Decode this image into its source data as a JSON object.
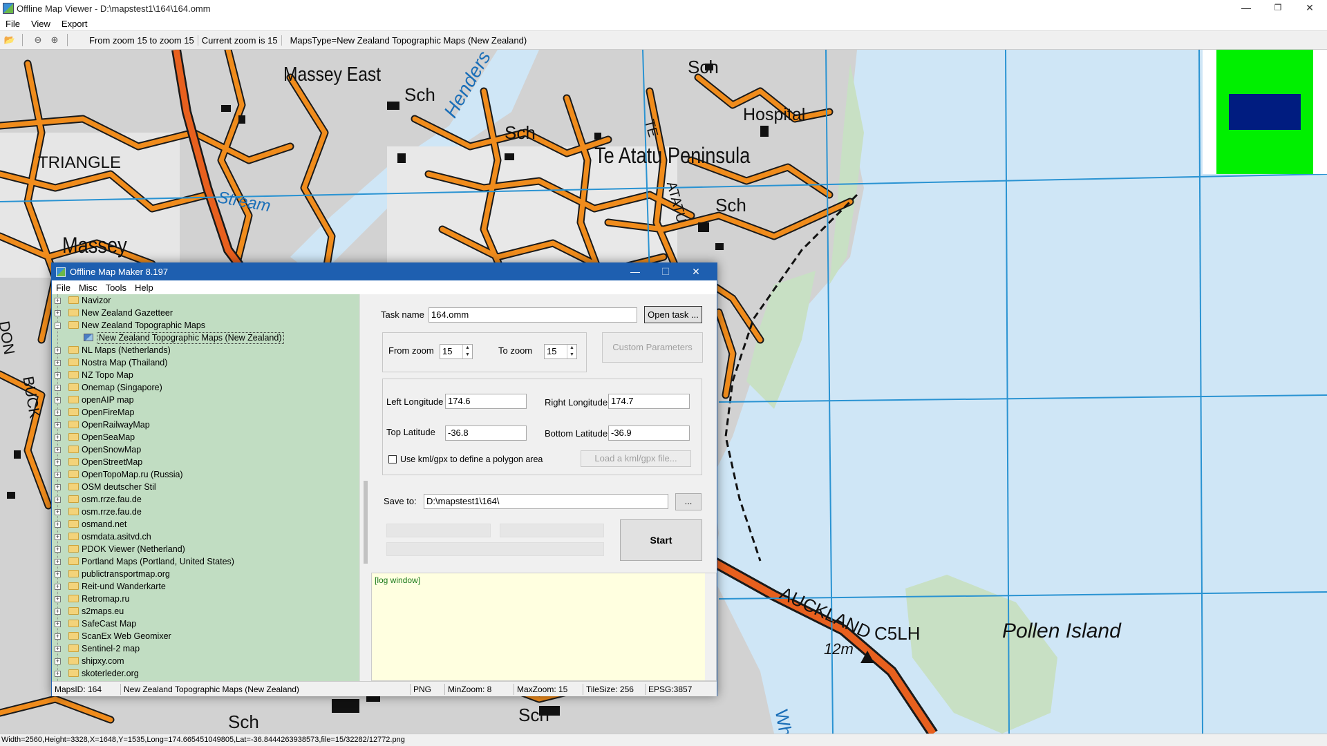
{
  "window": {
    "title": "Offline Map Viewer - D:\\mapstest1\\164\\164.omm",
    "controls": {
      "minimize": "—",
      "restore": "❐",
      "close": "✕"
    }
  },
  "menubar": [
    "File",
    "View",
    "Export"
  ],
  "toolbar": {
    "icons": [
      "open-folder-icon",
      "zoom-out-icon",
      "zoom-in-icon"
    ],
    "zoom_range": "From zoom 15 to zoom 15",
    "current_zoom": "Current zoom is 15",
    "maps_type": "MapsType=New Zealand Topographic Maps (New Zealand)"
  },
  "map": {
    "labels": {
      "massey_east": "Massey East",
      "sch": "Sch",
      "henders": "Henders",
      "hospital": "Hospital",
      "te": "TE",
      "te_atatu_peninsula": "Te Atatu Peninsula",
      "atatu": "ATATU",
      "triangle": "TRIANGLE",
      "stream": "Stream",
      "massey": "Massey",
      "don": "DON",
      "buck": "BUCK",
      "auckland": "AUCKLAND",
      "c5lh": "C5LH",
      "pollen_island": "Pollen Island",
      "height_12m": "12m",
      "wh": "Wh"
    },
    "colors": {
      "land": "#d2d2d2",
      "urban": "#e6e6e6",
      "road": "#f08c1c",
      "road_outline": "#1a1a1a",
      "highway": "#e8601e",
      "water": "#cfe6f6",
      "grid": "#2a93d2",
      "vegetation": "#c8e0c4"
    }
  },
  "minimap": {
    "outer_color": "#00f000",
    "inner_color": "#001c80"
  },
  "statusbar": "Width=2560,Height=3328,X=1648,Y=1535,Long=174.665451049805,Lat=-36.8444263938573,file=15/32282/12772.png",
  "dialog": {
    "title": "Offline Map Maker 8.197",
    "controls": {
      "minimize": "—",
      "maximize": "☐",
      "close": "✕"
    },
    "menu": [
      "File",
      "Misc",
      "Tools",
      "Help"
    ],
    "tree": [
      {
        "label": "Navizor",
        "expander": "+"
      },
      {
        "label": "New Zealand Gazetteer",
        "expander": "+"
      },
      {
        "label": "New Zealand Topographic Maps",
        "expander": "−",
        "open": true
      },
      {
        "label": "New Zealand Topographic Maps (New Zealand)",
        "child": true
      },
      {
        "label": "NL Maps (Netherlands)",
        "expander": "+"
      },
      {
        "label": "Nostra Map (Thailand)",
        "expander": "+"
      },
      {
        "label": "NZ Topo Map",
        "expander": "+"
      },
      {
        "label": "Onemap (Singapore)",
        "expander": "+"
      },
      {
        "label": "openAIP map",
        "expander": "+"
      },
      {
        "label": "OpenFireMap",
        "expander": "+"
      },
      {
        "label": "OpenRailwayMap",
        "expander": "+"
      },
      {
        "label": "OpenSeaMap",
        "expander": "+"
      },
      {
        "label": "OpenSnowMap",
        "expander": "+"
      },
      {
        "label": "OpenStreetMap",
        "expander": "+"
      },
      {
        "label": "OpenTopoMap.ru (Russia)",
        "expander": "+"
      },
      {
        "label": "OSM deutscher Stil",
        "expander": "+"
      },
      {
        "label": "osm.rrze.fau.de",
        "expander": "+"
      },
      {
        "label": "osm.rrze.fau.de",
        "expander": "+"
      },
      {
        "label": "osmand.net",
        "expander": "+"
      },
      {
        "label": "osmdata.asitvd.ch",
        "expander": "+"
      },
      {
        "label": "PDOK Viewer (Netherland)",
        "expander": "+"
      },
      {
        "label": "Portland Maps (Portland, United States)",
        "expander": "+"
      },
      {
        "label": "publictransportmap.org",
        "expander": "+"
      },
      {
        "label": "Reit-und Wanderkarte",
        "expander": "+"
      },
      {
        "label": "Retromap.ru",
        "expander": "+"
      },
      {
        "label": "s2maps.eu",
        "expander": "+"
      },
      {
        "label": "SafeCast Map",
        "expander": "+"
      },
      {
        "label": "ScanEx Web Geomixer",
        "expander": "+"
      },
      {
        "label": "Sentinel-2 map",
        "expander": "+"
      },
      {
        "label": "shipxy.com",
        "expander": "+"
      },
      {
        "label": "skoterleder.org",
        "expander": "+"
      }
    ],
    "task_name_label": "Task name",
    "task_name_value": "164.omm",
    "open_task_button": "Open task ...",
    "from_zoom_label": "From zoom",
    "from_zoom_value": "15",
    "to_zoom_label": "To zoom",
    "to_zoom_value": "15",
    "custom_parameters_button": "Custom Parameters",
    "left_longitude_label": "Left Longitude",
    "left_longitude_value": "174.6",
    "right_longitude_label": "Right Longitude",
    "right_longitude_value": "174.7",
    "top_latitude_label": "Top Latitude",
    "top_latitude_value": "-36.8",
    "bottom_latitude_label": "Bottom Latitude",
    "bottom_latitude_value": "-36.9",
    "kml_checkbox_label": "Use kml/gpx to define a polygon area",
    "load_kml_button": "Load a kml/gpx file...",
    "save_to_label": "Save to:",
    "save_to_value": "D:\\mapstest1\\164\\",
    "browse_button": "...",
    "start_button": "Start",
    "log_text": "[log window]",
    "status": {
      "maps_id": "MapsID: 164",
      "maps_name": "New Zealand Topographic Maps (New Zealand)",
      "format": "PNG",
      "min_zoom": "MinZoom: 8",
      "max_zoom": "MaxZoom: 15",
      "tile_size": "TileSize: 256",
      "epsg": "EPSG:3857"
    }
  }
}
